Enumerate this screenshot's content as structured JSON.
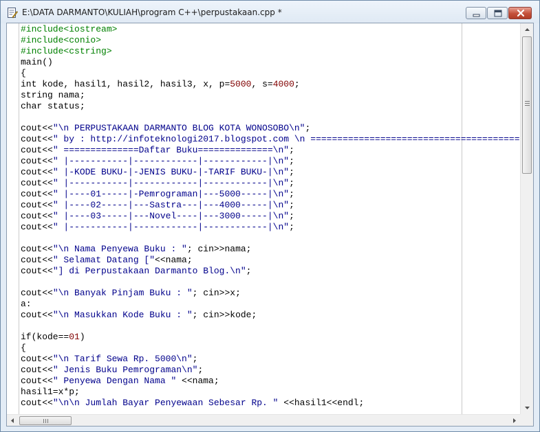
{
  "window": {
    "title": "E:\\DATA DARMANTO\\KULIAH\\program C++\\perpustakaan.cpp *",
    "icon": "document-edit-icon"
  },
  "controls": {
    "minimize": "minimize-icon",
    "maximize": "maximize-icon",
    "close": "close-icon"
  },
  "colors": {
    "preprocessor": "#008000",
    "string": "#00008b",
    "number": "#800000",
    "text": "#000000"
  },
  "code_lines": [
    [
      [
        "pre",
        "#include<iostream>"
      ]
    ],
    [
      [
        "pre",
        "#include<conio>"
      ]
    ],
    [
      [
        "pre",
        "#include<cstring>"
      ]
    ],
    [
      [
        "plain",
        "main()"
      ]
    ],
    [
      [
        "plain",
        "{"
      ]
    ],
    [
      [
        "plain",
        "int kode, hasil1, hasil2, hasil3, x, p="
      ],
      [
        "num",
        "5000"
      ],
      [
        "plain",
        ", s="
      ],
      [
        "num",
        "4000"
      ],
      [
        "plain",
        ";"
      ]
    ],
    [
      [
        "plain",
        "string nama;"
      ]
    ],
    [
      [
        "plain",
        "char status;"
      ]
    ],
    [],
    [
      [
        "plain",
        "cout<<"
      ],
      [
        "str",
        "\"\\n PERPUSTAKAAN DARMANTO BLOG KOTA WONOSOBO\\n\""
      ],
      [
        "plain",
        ";"
      ]
    ],
    [
      [
        "plain",
        "cout<<"
      ],
      [
        "str",
        "\" by : http://infoteknologi2017.blogspot.com \\n ========================================"
      ]
    ],
    [
      [
        "plain",
        "cout<<"
      ],
      [
        "str",
        "\" ==============Daftar Buku==============\\n\""
      ],
      [
        "plain",
        ";"
      ]
    ],
    [
      [
        "plain",
        "cout<<"
      ],
      [
        "str",
        "\" |-----------|------------|------------|\\n\""
      ],
      [
        "plain",
        ";"
      ]
    ],
    [
      [
        "plain",
        "cout<<"
      ],
      [
        "str",
        "\" |-KODE BUKU-|-JENIS BUKU-|-TARIF BUKU-|\\n\""
      ],
      [
        "plain",
        ";"
      ]
    ],
    [
      [
        "plain",
        "cout<<"
      ],
      [
        "str",
        "\" |-----------|------------|------------|\\n\""
      ],
      [
        "plain",
        ";"
      ]
    ],
    [
      [
        "plain",
        "cout<<"
      ],
      [
        "str",
        "\" |----01-----|-Pemrograman|---5000-----|\\n\""
      ],
      [
        "plain",
        ";"
      ]
    ],
    [
      [
        "plain",
        "cout<<"
      ],
      [
        "str",
        "\" |----02-----|---Sastra---|---4000-----|\\n\""
      ],
      [
        "plain",
        ";"
      ]
    ],
    [
      [
        "plain",
        "cout<<"
      ],
      [
        "str",
        "\" |----03-----|---Novel----|---3000-----|\\n\""
      ],
      [
        "plain",
        ";"
      ]
    ],
    [
      [
        "plain",
        "cout<<"
      ],
      [
        "str",
        "\" |-----------|------------|------------|\\n\""
      ],
      [
        "plain",
        ";"
      ]
    ],
    [],
    [
      [
        "plain",
        "cout<<"
      ],
      [
        "str",
        "\"\\n Nama Penyewa Buku : \""
      ],
      [
        "plain",
        "; cin>>nama;"
      ]
    ],
    [
      [
        "plain",
        "cout<<"
      ],
      [
        "str",
        "\" Selamat Datang [\""
      ],
      [
        "plain",
        "<<nama;"
      ]
    ],
    [
      [
        "plain",
        "cout<<"
      ],
      [
        "str",
        "\"] di Perpustakaan Darmanto Blog.\\n\""
      ],
      [
        "plain",
        ";"
      ]
    ],
    [],
    [
      [
        "plain",
        "cout<<"
      ],
      [
        "str",
        "\"\\n Banyak Pinjam Buku : \""
      ],
      [
        "plain",
        "; cin>>x;"
      ]
    ],
    [
      [
        "plain",
        "a:"
      ]
    ],
    [
      [
        "plain",
        "cout<<"
      ],
      [
        "str",
        "\"\\n Masukkan Kode Buku : \""
      ],
      [
        "plain",
        "; cin>>kode;"
      ]
    ],
    [],
    [
      [
        "plain",
        "if(kode=="
      ],
      [
        "num",
        "01"
      ],
      [
        "plain",
        ")"
      ]
    ],
    [
      [
        "plain",
        "{"
      ]
    ],
    [
      [
        "plain",
        "cout<<"
      ],
      [
        "str",
        "\"\\n Tarif Sewa Rp. 5000\\n\""
      ],
      [
        "plain",
        ";"
      ]
    ],
    [
      [
        "plain",
        "cout<<"
      ],
      [
        "str",
        "\" Jenis Buku Pemrograman\\n\""
      ],
      [
        "plain",
        ";"
      ]
    ],
    [
      [
        "plain",
        "cout<<"
      ],
      [
        "str",
        "\" Penyewa Dengan Nama \""
      ],
      [
        "plain",
        " <<nama;"
      ]
    ],
    [
      [
        "plain",
        "hasil1=x*p;"
      ]
    ],
    [
      [
        "plain",
        "cout<<"
      ],
      [
        "str",
        "\"\\n\\n Jumlah Bayar Penyewaan Sebesar Rp. \""
      ],
      [
        "plain",
        " <<hasil1<<endl;"
      ]
    ]
  ],
  "scrollbars": {
    "vertical": {
      "up": "scroll-up-arrow-icon",
      "down": "scroll-down-arrow-icon",
      "position": 0
    },
    "horizontal": {
      "left": "scroll-left-arrow-icon",
      "right": "scroll-right-arrow-icon",
      "position": 0
    }
  }
}
